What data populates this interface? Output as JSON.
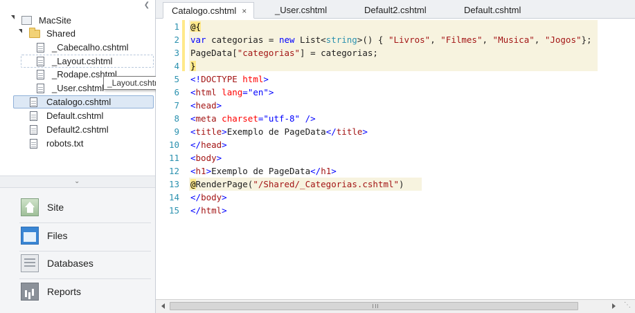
{
  "sidebar": {
    "tree": {
      "root": "MacSite",
      "folder": "Shared",
      "shared_files": [
        "_Cabecalho.cshtml",
        "_Layout.cshtml",
        "_Rodape.cshtml",
        "_User.cshtml"
      ],
      "files": [
        "Catalogo.cshtml",
        "Default.cshtml",
        "Default2.cshtml",
        "robots.txt"
      ],
      "tooltip": "_Layout.cshtml"
    },
    "nav": [
      "Site",
      "Files",
      "Databases",
      "Reports"
    ]
  },
  "tabs": [
    {
      "label": "Catalogo.cshtml",
      "close": "×"
    },
    {
      "label": "_User.cshtml"
    },
    {
      "label": "Default2.cshtml"
    },
    {
      "label": "Default.cshtml"
    }
  ],
  "code": {
    "line_numbers": [
      "1",
      "2",
      "3",
      "4",
      "5",
      "6",
      "7",
      "8",
      "9",
      "10",
      "11",
      "12",
      "13",
      "14",
      "15"
    ],
    "l1": "@{",
    "l2": [
      "var",
      " categorias = ",
      "new",
      " List<",
      "string",
      ">() { ",
      "\"Livros\"",
      ", ",
      "\"Filmes\"",
      ", ",
      "\"Musica\"",
      ", ",
      "\"Jogos\"",
      "};"
    ],
    "l3": [
      "PageData[",
      "\"categorias\"",
      "] = categorias;"
    ],
    "l4": "}",
    "l5": [
      "<!",
      "DOCTYPE",
      " ",
      "html",
      ">"
    ],
    "l6": [
      "<",
      "html",
      " ",
      "lang",
      "=",
      "\"en\"",
      ">"
    ],
    "l7": [
      "<",
      "head",
      ">"
    ],
    "l8": [
      "<",
      "meta",
      " ",
      "charset",
      "=",
      "\"utf-8\"",
      " />"
    ],
    "l9": [
      "<",
      "title",
      ">",
      "Exemplo de PageData",
      "</",
      "title",
      ">"
    ],
    "l10": [
      "</",
      "head",
      ">"
    ],
    "l11": [
      "<",
      "body",
      ">"
    ],
    "l12": [
      "<",
      "h1",
      ">",
      "Exemplo de PageData",
      "</",
      "h1",
      ">"
    ],
    "l13": [
      "@",
      "RenderPage(",
      "\"/Shared/_Categorias.cshtml\"",
      ")"
    ],
    "l14": [
      "</",
      "body",
      ">"
    ],
    "l15": [
      "</",
      "html",
      ">"
    ]
  },
  "icons": {
    "tree_collapse": "chevron-left-icon",
    "splitter": "chevron-down-icon",
    "scroll_grip": "grip-icon"
  },
  "colors": {
    "keyword": "#0000ff",
    "tag": "#a31515",
    "type": "#2b91af",
    "attribute": "#ff0000",
    "razor_bg": "#f7f3df",
    "razor_marker": "#ffe98a",
    "selection": "#dde8f5"
  }
}
